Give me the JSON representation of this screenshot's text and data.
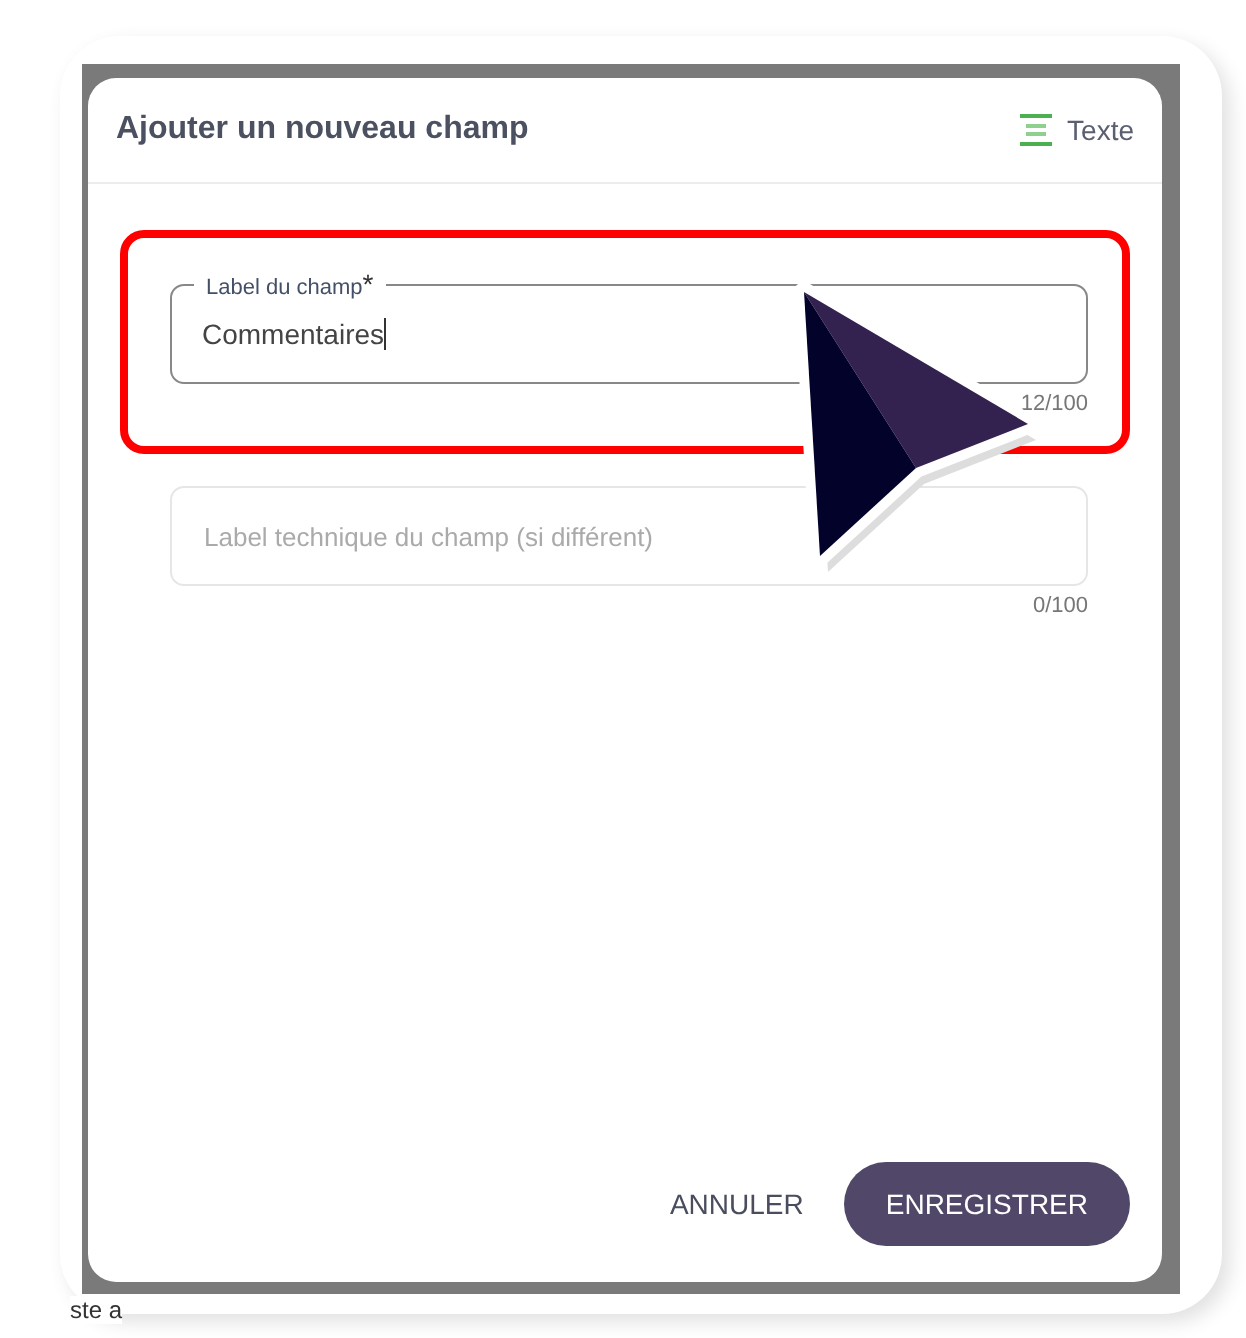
{
  "dialog": {
    "title": "Ajouter un nouveau champ",
    "type_label": "Texte"
  },
  "fields": [
    {
      "label": "Label du champ",
      "required_mark": "*",
      "value": "Commentaires",
      "counter": "12/100",
      "highlighted": true
    },
    {
      "placeholder": "Label technique du champ (si différent)",
      "counter": "0/100",
      "highlighted": false
    }
  ],
  "buttons": [
    {
      "label": "ANNULER",
      "kind": "text"
    },
    {
      "label": "ENREGISTRER",
      "kind": "filled"
    }
  ],
  "backdrop_text": "ste a"
}
